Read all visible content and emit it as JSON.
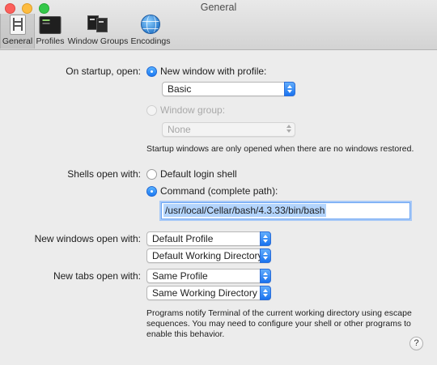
{
  "window": {
    "title": "General"
  },
  "toolbar": {
    "tabs": [
      {
        "label": "General",
        "icon": "general-prefs-icon",
        "active": true
      },
      {
        "label": "Profiles",
        "icon": "terminal-profiles-icon"
      },
      {
        "label": "Window Groups",
        "icon": "window-groups-icon"
      },
      {
        "label": "Encodings",
        "icon": "globe-icon"
      }
    ]
  },
  "startup": {
    "label": "On startup, open:",
    "new_window_option": "New window with profile:",
    "profile_value": "Basic",
    "window_group_option": "Window group:",
    "window_group_value": "None",
    "note": "Startup windows are only opened when there are no windows restored."
  },
  "shells": {
    "label": "Shells open with:",
    "default_option": "Default login shell",
    "command_option": "Command (complete path):",
    "command_value": "/usr/local/Cellar/bash/4.3.33/bin/bash"
  },
  "new_windows": {
    "label": "New windows open with:",
    "profile_value": "Default Profile",
    "directory_value": "Default Working Directory"
  },
  "new_tabs": {
    "label": "New tabs open with:",
    "profile_value": "Same Profile",
    "directory_value": "Same Working Directory"
  },
  "footer_note": {
    "line1": "Programs notify Terminal of the current working directory using escape",
    "line2": "sequences. You may need to configure your shell or other programs to",
    "line3": "enable this behavior."
  },
  "help": {
    "label": "?"
  },
  "colors": {
    "accent": "#1b79f2",
    "background": "#ececec"
  }
}
